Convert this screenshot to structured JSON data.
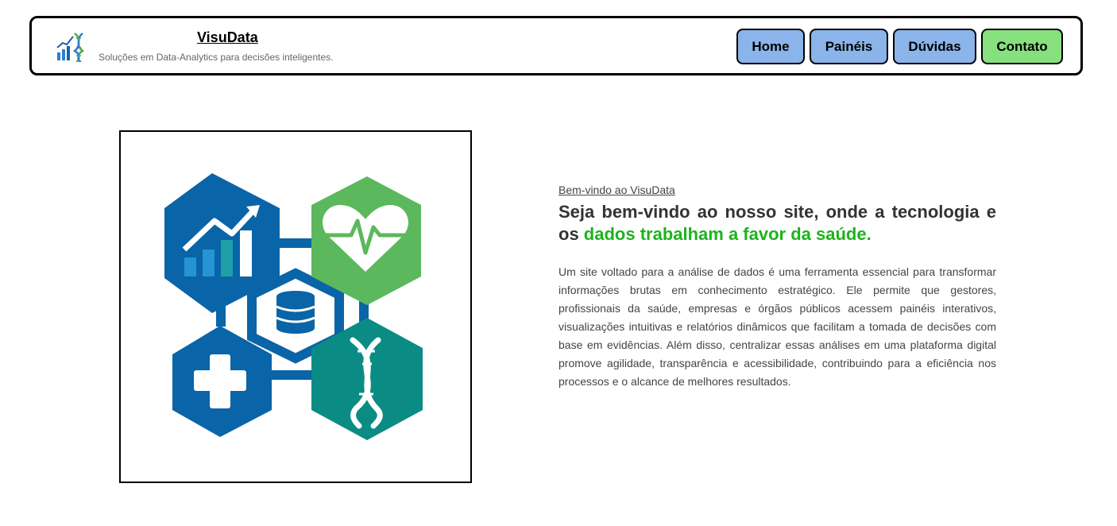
{
  "header": {
    "title": "VisuData",
    "subtitle": "Soluções em Data-Analytics para decisões inteligentes.",
    "logo_icon": "chart-dna-logo-icon"
  },
  "nav": {
    "items": [
      {
        "label": "Home",
        "color": "#8ab4ea"
      },
      {
        "label": "Painéis",
        "color": "#8ab4ea"
      },
      {
        "label": "Dúvidas",
        "color": "#8ab4ea"
      },
      {
        "label": "Contato",
        "color": "#86e07e"
      }
    ]
  },
  "hero": {
    "illustration_icons": [
      "growth-chart-icon",
      "heart-pulse-icon",
      "database-icon",
      "medical-cross-icon",
      "dna-icon"
    ],
    "eyebrow": "Bem-vindo ao VisuData",
    "headline_part1": "Seja bem-vindo ao nosso site, onde a tecnologia e os ",
    "headline_highlight": "dados trabalham a favor da saúde.",
    "body": "Um site voltado para a análise de dados é uma ferramenta essencial para transformar informações brutas em conhecimento estratégico. Ele permite que gestores, profissionais da saúde, empresas e órgãos públicos acessem painéis interativos, visualizações intuitivas e relatórios dinâmicos que facilitam a tomada de decisões com base em evidências. Além disso, centralizar essas análises em uma plataforma digital promove agilidade, transparência e acessibilidade, contribuindo para a eficiência nos processos e o alcance de melhores resultados."
  },
  "colors": {
    "blue": "#0a64a8",
    "green": "#5cb85c",
    "teal": "#0a8c84",
    "highlight": "#1db31d"
  }
}
